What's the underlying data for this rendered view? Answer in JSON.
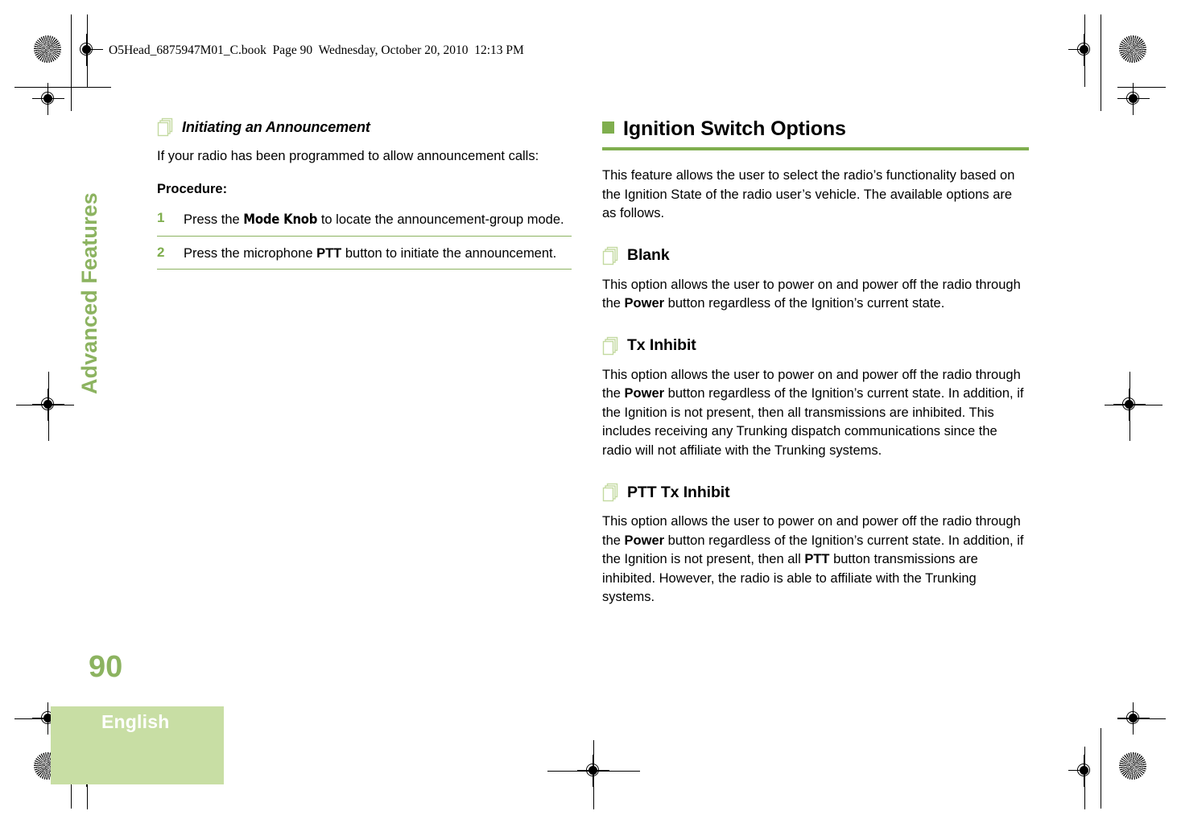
{
  "page": {
    "file_header": "O5Head_6875947M01_C.book  Page 90  Wednesday, October 20, 2010  12:13 PM",
    "page_number": "90",
    "language": "English",
    "chapter": "Advanced Features"
  },
  "colors": {
    "accent_green": "#7fae4e",
    "sidebar_green": "#8cb360",
    "language_block": "#c8dea4",
    "icon_green": "#c3d9a0"
  },
  "left_column": {
    "heading": {
      "icon": "stacked-pages-icon",
      "label": "Initiating an Announcement"
    },
    "intro": {
      "part1": "If your radio has been programmed to allow announcement calls:"
    },
    "procedure_label": "Procedure:",
    "steps": [
      {
        "number": "1",
        "text_before": "Press the ",
        "bold": "Mode Knob",
        "text_after": " to locate the announcement-group mode."
      },
      {
        "number": "2",
        "text_before": "Press the microphone ",
        "bold": "PTT",
        "text_after": " button to initiate the announcement."
      }
    ]
  },
  "right_column": {
    "section_heading": {
      "bullet": "green-square",
      "label": "Ignition Switch Options"
    },
    "intro": "This feature allows the user to select the radio’s functionality based on the Ignition State of the radio user’s vehicle. The available options are as follows.",
    "subsections": [
      {
        "icon": "stacked-pages-icon",
        "title": "Blank",
        "p1_before": "This option allows the user to power on and power off the radio through the ",
        "p1_bold1": "Power",
        "p1_after": " button regardless of the Ignition’s current state."
      },
      {
        "icon": "stacked-pages-icon",
        "title": "Tx Inhibit",
        "p1_before": "This option allows the user to power on and power off the radio through the ",
        "p1_bold1": "Power",
        "p1_after": " button regardless of the Ignition’s current state. In addition, if the Ignition is not present, then all transmissions are inhibited. This includes receiving any Trunking dispatch communications since the radio will not affiliate with the Trunking systems."
      },
      {
        "icon": "stacked-pages-icon",
        "title": "PTT Tx Inhibit",
        "p1_before": "This option allows the user to power on and power off the radio through the ",
        "p1_bold1": "Power",
        "p1_mid": " button regardless of the Ignition’s current state. In addition, if the Ignition is not present, then all ",
        "p1_bold2": "PTT",
        "p1_after": " button transmissions are inhibited. However, the radio is able to affiliate with the Trunking systems."
      }
    ]
  }
}
